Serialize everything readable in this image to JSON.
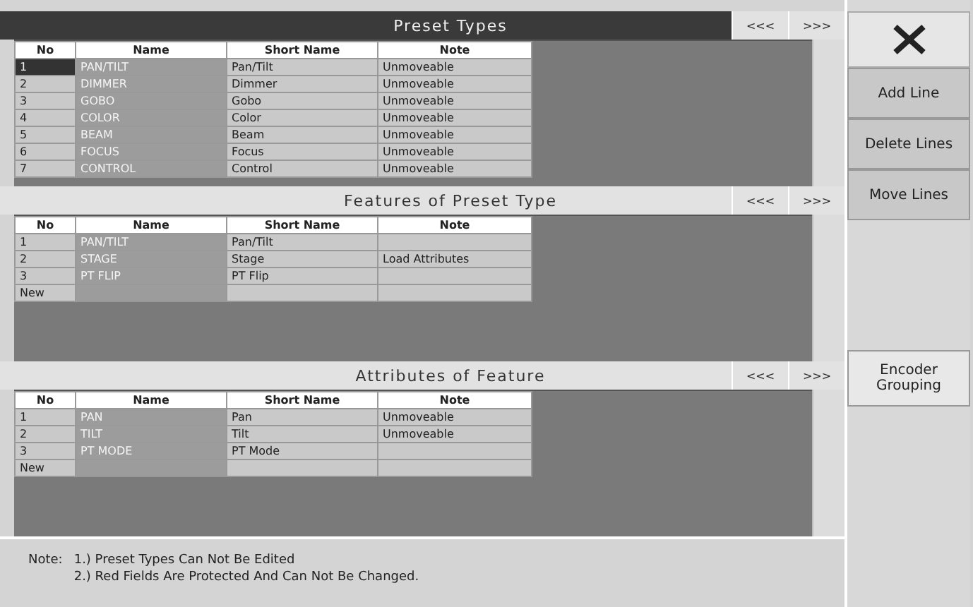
{
  "sections": [
    {
      "title": "Preset Types",
      "active": true,
      "nav": [
        "<<<",
        ">>>"
      ],
      "columns": [
        "No",
        "Name",
        "Short Name",
        "Note"
      ],
      "rows": [
        {
          "cells": [
            "1",
            "PAN/TILT",
            "Pan/Tilt",
            "Unmoveable"
          ],
          "selected": true
        },
        {
          "cells": [
            "2",
            "DIMMER",
            "Dimmer",
            "Unmoveable"
          ],
          "selected": false
        },
        {
          "cells": [
            "3",
            "GOBO",
            "Gobo",
            "Unmoveable"
          ],
          "selected": false
        },
        {
          "cells": [
            "4",
            "COLOR",
            "Color",
            "Unmoveable"
          ],
          "selected": false
        },
        {
          "cells": [
            "5",
            "BEAM",
            "Beam",
            "Unmoveable"
          ],
          "selected": false
        },
        {
          "cells": [
            "6",
            "FOCUS",
            "Focus",
            "Unmoveable"
          ],
          "selected": false
        },
        {
          "cells": [
            "7",
            "CONTROL",
            "Control",
            "Unmoveable"
          ],
          "selected": false
        }
      ]
    },
    {
      "title": "Features of Preset Type",
      "active": false,
      "nav": [
        "<<<",
        ">>>"
      ],
      "columns": [
        "No",
        "Name",
        "Short Name",
        "Note"
      ],
      "rows": [
        {
          "cells": [
            "1",
            "PAN/TILT",
            "Pan/Tilt",
            ""
          ],
          "selected": false
        },
        {
          "cells": [
            "2",
            "STAGE",
            "Stage",
            "Load Attributes"
          ],
          "selected": false
        },
        {
          "cells": [
            "3",
            "PT FLIP",
            "PT Flip",
            ""
          ],
          "selected": false
        },
        {
          "cells": [
            "New",
            "",
            "",
            ""
          ],
          "selected": false
        }
      ]
    },
    {
      "title": "Attributes of Feature",
      "active": false,
      "nav": [
        "<<<",
        ">>>"
      ],
      "columns": [
        "No",
        "Name",
        "Short Name",
        "Note"
      ],
      "rows": [
        {
          "cells": [
            "1",
            "PAN",
            "Pan",
            "Unmoveable"
          ],
          "selected": false
        },
        {
          "cells": [
            "2",
            "TILT",
            "Tilt",
            "Unmoveable"
          ],
          "selected": false
        },
        {
          "cells": [
            "3",
            "PT MODE",
            "PT Mode",
            ""
          ],
          "selected": false
        },
        {
          "cells": [
            "New",
            "",
            "",
            ""
          ],
          "selected": false
        }
      ]
    }
  ],
  "side_buttons": [
    "Add Line",
    "Delete Lines",
    "Move Lines"
  ],
  "encoder_button": "Encoder Grouping",
  "note": {
    "label": "Note:",
    "lines": [
      "1.) Preset Types Can Not Be Edited",
      "2.) Red Fields Are Protected And Can Not Be Changed."
    ]
  }
}
